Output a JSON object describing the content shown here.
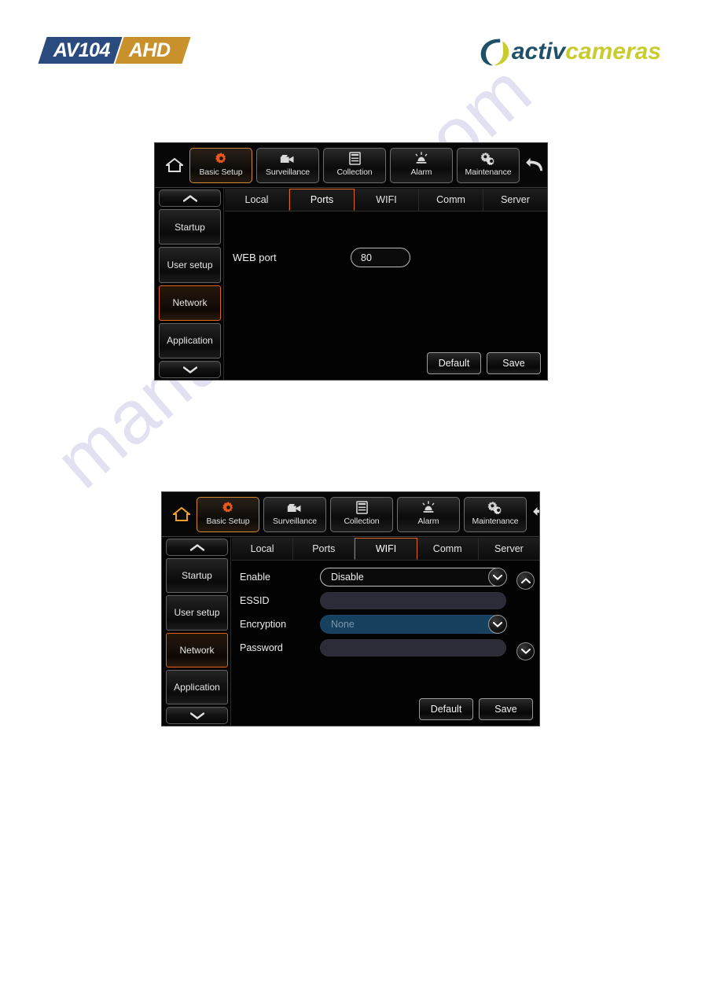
{
  "header": {
    "product_logo": {
      "model": "AV104",
      "variant": "AHD"
    },
    "brand_logo": {
      "part1": "activ",
      "part2": "cameras"
    }
  },
  "watermark": {
    "text": "manualshive.com"
  },
  "panels": [
    {
      "id": "ports",
      "topnav": {
        "home_icon": "home-icon",
        "back_icon": "back-arrow-icon",
        "home_highlighted": false,
        "buttons": [
          {
            "label": "Basic Setup",
            "icon": "gear-icon",
            "active": true
          },
          {
            "label": "Surveillance",
            "icon": "camcorder-icon",
            "active": false
          },
          {
            "label": "Collection",
            "icon": "document-icon",
            "active": false
          },
          {
            "label": "Alarm",
            "icon": "alarm-siren-icon",
            "active": false
          },
          {
            "label": "Maintenance",
            "icon": "double-gear-icon",
            "active": false
          }
        ]
      },
      "sidebar": {
        "scroll_up_icon": "chevron-up-icon",
        "scroll_down_icon": "chevron-down-icon",
        "items": [
          {
            "label": "Startup",
            "active": false
          },
          {
            "label": "User setup",
            "active": false
          },
          {
            "label": "Network",
            "active": true
          },
          {
            "label": "Application",
            "active": false
          }
        ]
      },
      "tabs": [
        {
          "label": "Local",
          "active": false
        },
        {
          "label": "Ports",
          "active": true
        },
        {
          "label": "WIFI",
          "active": false
        },
        {
          "label": "Comm",
          "active": false
        },
        {
          "label": "Server",
          "active": false
        }
      ],
      "form": {
        "web_port": {
          "label": "WEB port",
          "value": "80"
        }
      },
      "actions": {
        "default_label": "Default",
        "save_label": "Save"
      }
    },
    {
      "id": "wifi",
      "topnav": {
        "home_icon": "home-icon",
        "back_icon": "back-arrow-icon",
        "home_highlighted": true,
        "buttons": [
          {
            "label": "Basic Setup",
            "icon": "gear-icon",
            "active": true
          },
          {
            "label": "Surveillance",
            "icon": "camcorder-icon",
            "active": false
          },
          {
            "label": "Collection",
            "icon": "document-icon",
            "active": false
          },
          {
            "label": "Alarm",
            "icon": "alarm-siren-icon",
            "active": false
          },
          {
            "label": "Maintenance",
            "icon": "double-gear-icon",
            "active": false
          }
        ]
      },
      "sidebar": {
        "scroll_up_icon": "chevron-up-icon",
        "scroll_down_icon": "chevron-down-icon",
        "items": [
          {
            "label": "Startup",
            "active": false
          },
          {
            "label": "User setup",
            "active": false
          },
          {
            "label": "Network",
            "active": true
          },
          {
            "label": "Application",
            "active": false
          }
        ]
      },
      "tabs": [
        {
          "label": "Local",
          "active": false
        },
        {
          "label": "Ports",
          "active": false
        },
        {
          "label": "WIFI",
          "active": true
        },
        {
          "label": "Comm",
          "active": false
        },
        {
          "label": "Server",
          "active": false
        }
      ],
      "form": {
        "enable": {
          "label": "Enable",
          "value": "Disable",
          "type": "select"
        },
        "essid": {
          "label": "ESSID",
          "value": "",
          "type": "text"
        },
        "encryption": {
          "label": "Encryption",
          "value": "None",
          "type": "select-disabled"
        },
        "password": {
          "label": "Password",
          "value": "",
          "type": "text"
        }
      },
      "scroll": {
        "up_icon": "chevron-up-circle-icon",
        "down_icon": "chevron-down-circle-icon"
      },
      "actions": {
        "default_label": "Default",
        "save_label": "Save"
      }
    }
  ],
  "colors": {
    "accent_orange": "#e2641a",
    "panel_bg": "#050505",
    "brand_blue": "#1f5068",
    "brand_yellow": "#c8cc2e",
    "logo_blue": "#2b4a7d",
    "logo_gold": "#c8912c"
  }
}
